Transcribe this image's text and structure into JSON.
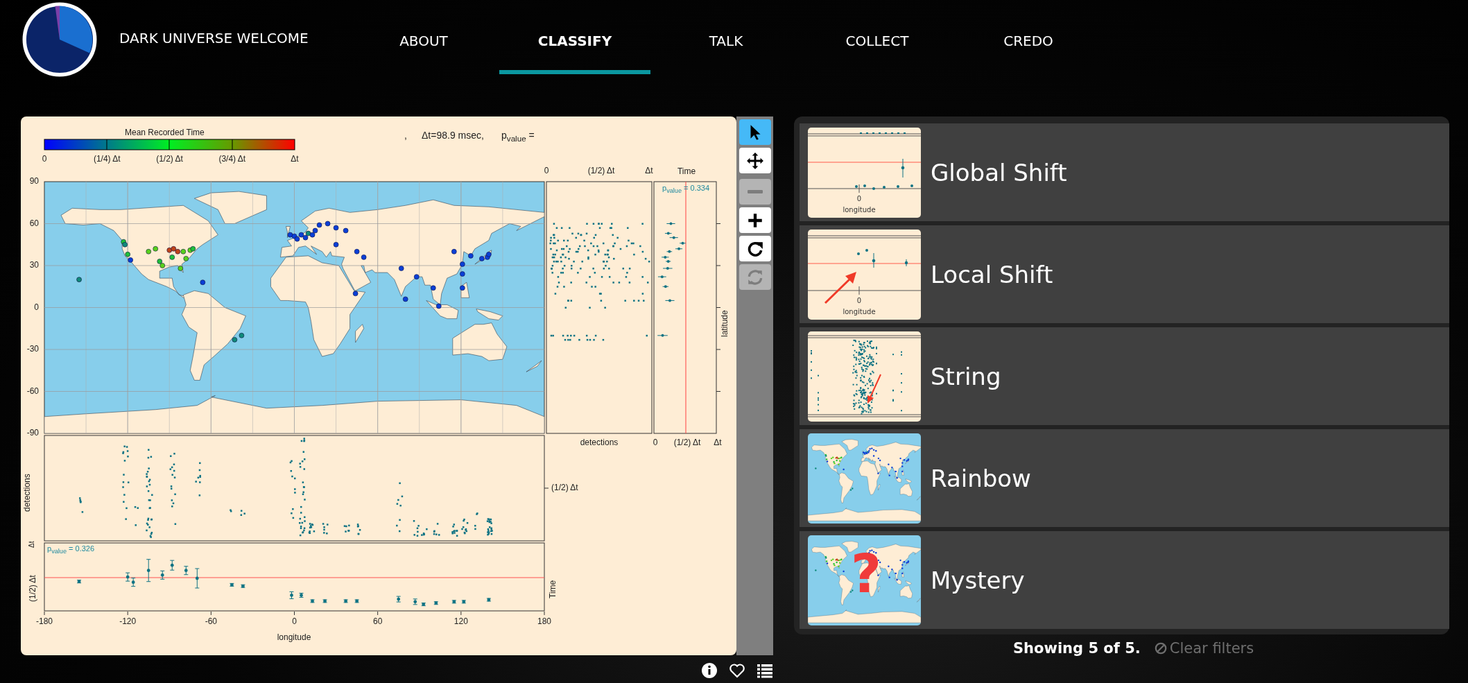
{
  "nav": {
    "brand": "DARK UNIVERSE WELCOME",
    "items": [
      {
        "label": "ABOUT",
        "selected": false
      },
      {
        "label": "CLASSIFY",
        "selected": true
      },
      {
        "label": "TALK",
        "selected": false
      },
      {
        "label": "COLLECT",
        "selected": false
      },
      {
        "label": "CREDO",
        "selected": false
      }
    ]
  },
  "plot": {
    "colorbar": {
      "title": "Mean Recorded Time",
      "ticks": [
        "0",
        "(1/4) Δt",
        "(1/2) Δt",
        "(3/4) Δt",
        "Δt"
      ]
    },
    "header": [
      ",",
      "Δt=98.9 msec,",
      "p$_{value}$ ="
    ],
    "map": {
      "yticks": [
        "90",
        "60",
        "30",
        "0",
        "-30",
        "-60",
        "-90"
      ],
      "ylabel": "latitude"
    },
    "side": {
      "top_ticks": [
        "0",
        "(1/2) Δt",
        "Δt"
      ],
      "time_label": "Time",
      "pvalue": "p$_{value}$ = 0.334",
      "xlabel": "detections",
      "bottom_ticks": [
        "0",
        "(1/2) Δt",
        "Δt"
      ]
    },
    "lower": {
      "ylabel": "detections",
      "right_tick": "(1/2) Δt",
      "corner_tick": "Δt"
    },
    "time": {
      "pvalue": "p$_{value}$ = 0.326",
      "left_tick": "(1/2) Δt",
      "right_label": "Time"
    },
    "xticks": [
      "-180",
      "-120",
      "-60",
      "0",
      "60",
      "120",
      "180"
    ],
    "xlabel": "longitude"
  },
  "tools": [
    {
      "kind": "pointer",
      "selected": true,
      "disabled": false
    },
    {
      "kind": "move",
      "selected": false,
      "disabled": false
    },
    {
      "kind": "minus",
      "selected": false,
      "disabled": true
    },
    {
      "kind": "plus",
      "selected": false,
      "disabled": false
    },
    {
      "kind": "redo",
      "selected": false,
      "disabled": false
    },
    {
      "kind": "refresh",
      "selected": false,
      "disabled": true
    }
  ],
  "cards": [
    {
      "title": "Global Shift",
      "kind": "time-plot",
      "tick": "0",
      "axis": "longitude"
    },
    {
      "title": "Local Shift",
      "kind": "time-plot-arrow",
      "tick": "0",
      "axis": "longitude"
    },
    {
      "title": "String",
      "kind": "string"
    },
    {
      "title": "Rainbow",
      "kind": "map"
    },
    {
      "title": "Mystery",
      "kind": "map-question",
      "overlay": "?"
    }
  ],
  "footer": {
    "count": "Showing 5 of 5.",
    "clear": "Clear filters"
  }
}
